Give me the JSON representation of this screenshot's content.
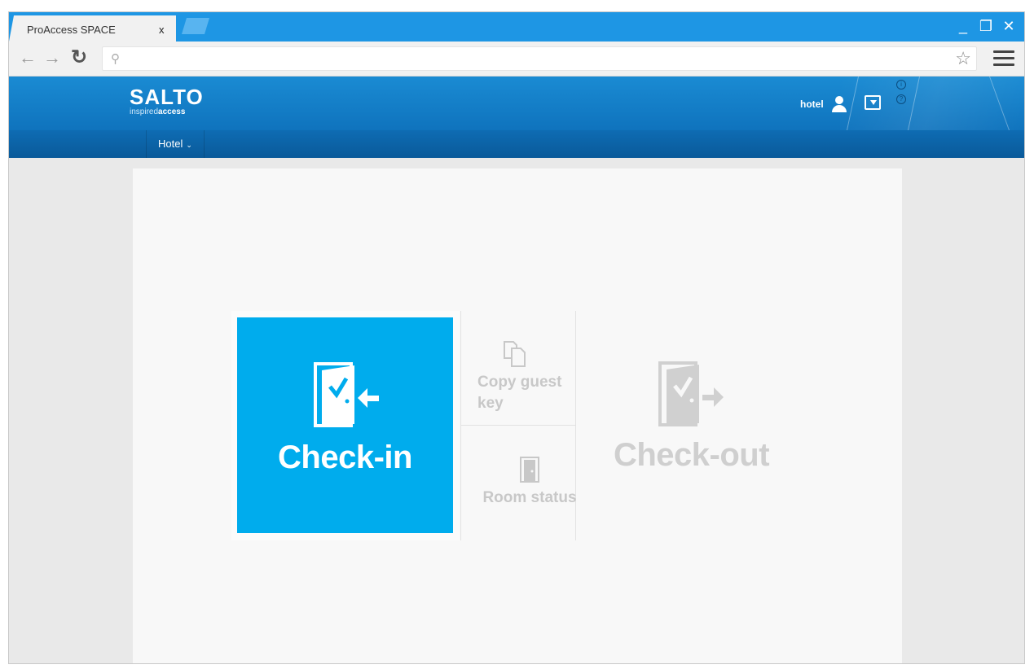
{
  "browser": {
    "tab_title": "ProAccess SPACE",
    "tab_close": "x",
    "address_value": "",
    "window_controls": {
      "minimize": "_",
      "restore": "❐",
      "close": "✕"
    }
  },
  "header": {
    "logo_main": "SALTO",
    "logo_sub_1": "inspired",
    "logo_sub_2": "access",
    "user_name": "hotel"
  },
  "nav": {
    "menu_label": "Hotel"
  },
  "tiles": {
    "checkin_label": "Check-in",
    "copy_key_label": "Copy guest key",
    "room_status_label": "Room status",
    "checkout_label": "Check-out"
  },
  "colors": {
    "tab_bar": "#1e96e4",
    "header": "#1a8bd3",
    "checkin_tile": "#00aced",
    "disabled_text": "#c8c8c8"
  }
}
